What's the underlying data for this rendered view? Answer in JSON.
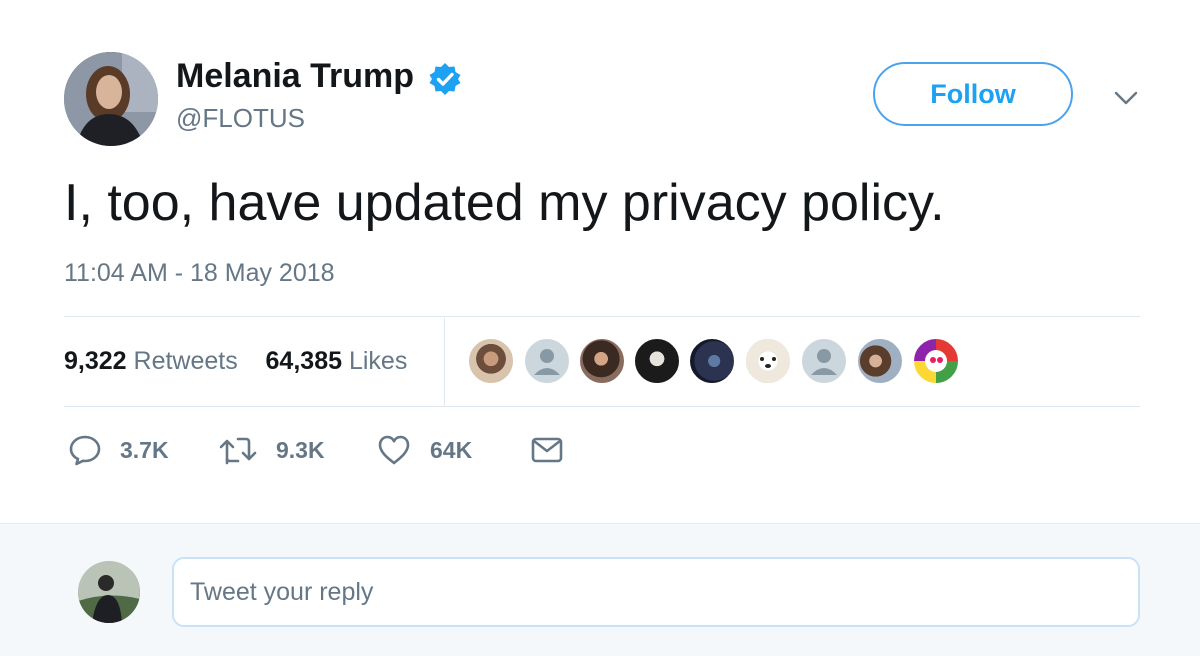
{
  "user": {
    "display_name": "Melania Trump",
    "handle": "@FLOTUS",
    "verified": true,
    "avatar": "profile-photo"
  },
  "follow_button": {
    "label": "Follow"
  },
  "tweet": {
    "text": "I, too, have updated my privacy policy.",
    "timestamp": "11:04 AM - 18 May 2018"
  },
  "stats": {
    "retweets_count": "9,322",
    "retweets_label": "Retweets",
    "likes_count": "64,385",
    "likes_label": "Likes",
    "liker_avatars": [
      "avatar",
      "default-avatar",
      "avatar",
      "avatar",
      "avatar",
      "dog-avatar",
      "default-avatar",
      "avatar",
      "cartoon-avatar"
    ]
  },
  "actions": {
    "reply_count": "3.7K",
    "retweet_count": "9.3K",
    "like_count": "64K"
  },
  "reply": {
    "placeholder": "Tweet your reply"
  },
  "colors": {
    "accent": "#1da1f2",
    "muted_text": "#657786",
    "primary_text": "#14171a",
    "divider": "#e1e8ed",
    "reply_bg": "#f5f8fa"
  }
}
